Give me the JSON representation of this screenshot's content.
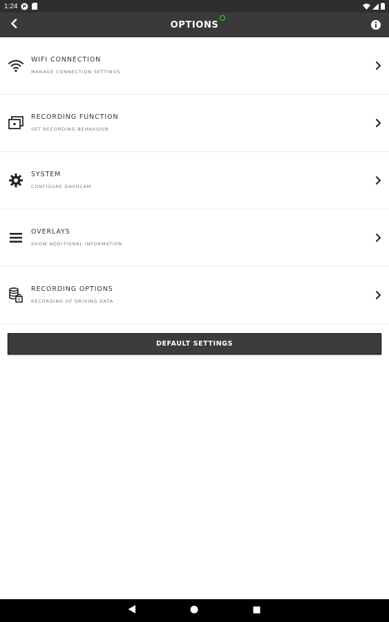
{
  "status_bar": {
    "time": "1:24",
    "icons": [
      "portrait-app-icon",
      "sd-card-icon",
      "wifi-icon",
      "cell-signal-icon",
      "battery-icon"
    ]
  },
  "app_bar": {
    "title": "OPTIONS",
    "back_icon": "chevron-left-icon",
    "info_icon": "info-icon",
    "connection_indicator_color": "#3fd13f"
  },
  "options": [
    {
      "title": "WIFI CONNECTION",
      "subtitle": "MANAGE CONNECTION SETTINGS",
      "icon": "wifi-icon"
    },
    {
      "title": "RECORDING FUNCTION",
      "subtitle": "SET RECORDING BEHAVIOUR",
      "icon": "recording-frames-icon"
    },
    {
      "title": "SYSTEM",
      "subtitle": "CONFIGURE DASHCAM",
      "icon": "gear-icon"
    },
    {
      "title": "OVERLAYS",
      "subtitle": "SHOW ADDITIONAL INFORMATION",
      "icon": "menu-lines-icon"
    },
    {
      "title": "RECORDING OPTIONS",
      "subtitle": "RECORDING OF DRIVING DATA",
      "icon": "database-lock-icon"
    }
  ],
  "default_button": {
    "label": "DEFAULT SETTINGS"
  },
  "nav_bar": {
    "icons": [
      "back-triangle-icon",
      "home-circle-icon",
      "recents-square-icon"
    ]
  },
  "colors": {
    "app_bar": "#3a3a3a",
    "status_bar": "#2e2e2e",
    "button": "#3c3c3c",
    "text_primary": "#333333",
    "text_secondary": "#777777"
  }
}
